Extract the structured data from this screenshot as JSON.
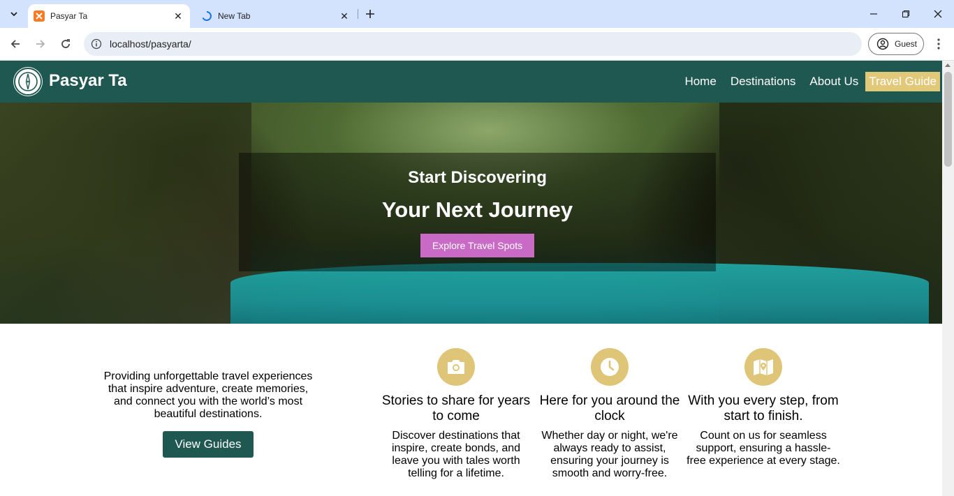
{
  "browser": {
    "tabs": [
      {
        "title": "Pasyar Ta",
        "active": true
      },
      {
        "title": "New Tab",
        "active": false
      }
    ],
    "url": "localhost/pasyarta/",
    "profile_label": "Guest"
  },
  "site": {
    "brand": "Pasyar Ta",
    "nav": [
      "Home",
      "Destinations",
      "About Us",
      "Travel Guide"
    ],
    "hero": {
      "subtitle": "Start Discovering",
      "title": "Your Next Journey",
      "button": "Explore Travel Spots"
    },
    "intro": {
      "text": "Providing unforgettable travel experiences that inspire adventure, create memories, and connect you with the world’s most beautiful destinations.",
      "button": "View Guides"
    },
    "features": [
      {
        "icon": "camera-icon",
        "title": "Stories to share for years to come",
        "text": "Discover destinations that inspire, create bonds, and leave you with tales worth telling for a lifetime."
      },
      {
        "icon": "clock-icon",
        "title": "Here for you around the clock",
        "text": "Whether day or night, we're always ready to assist, ensuring your journey is smooth and worry-free."
      },
      {
        "icon": "map-icon",
        "title": "With you every step, from start to finish.",
        "text": "Count on us for seamless support, ensuring a hassle-free experience at every stage."
      }
    ]
  },
  "colors": {
    "header": "#1f5751",
    "accent_gold": "#e2c97a",
    "hero_button": "#c96bc6",
    "tabbar": "#d3e3fd"
  }
}
